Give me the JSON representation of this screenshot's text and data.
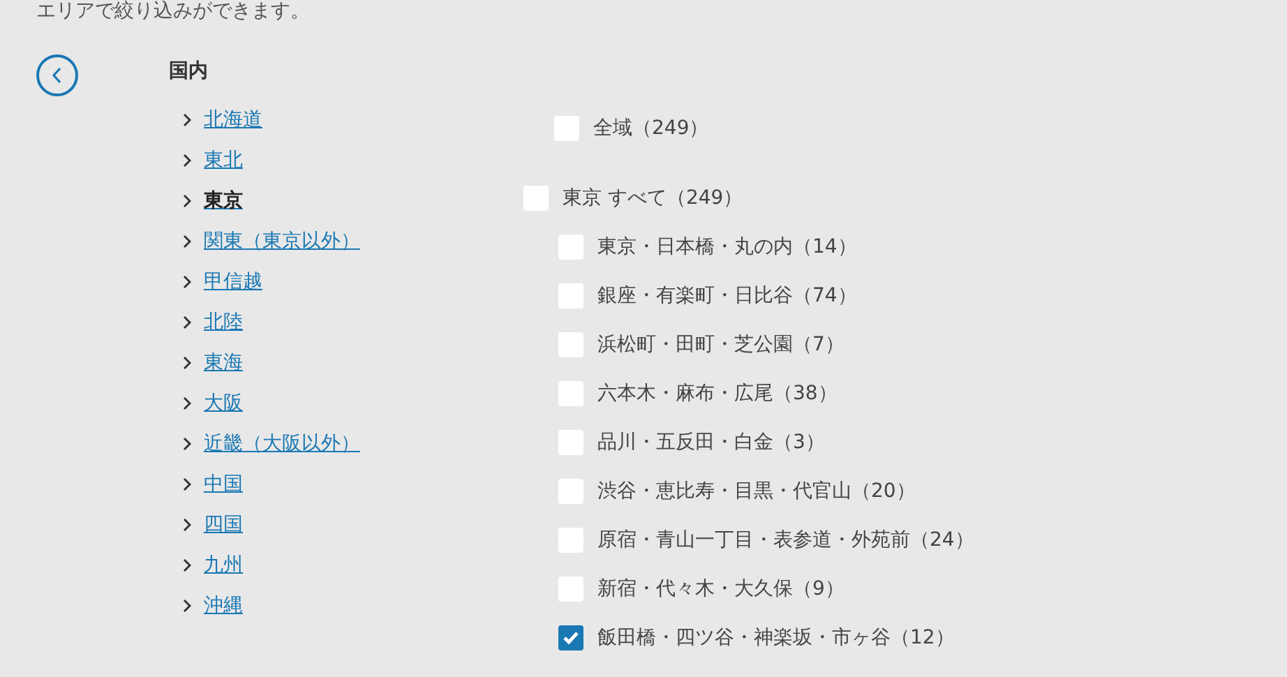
{
  "intro": "エリアで絞り込みができます。",
  "section_title": "国内",
  "regions": [
    {
      "label": "北海道",
      "selected": false
    },
    {
      "label": "東北",
      "selected": false
    },
    {
      "label": "東京",
      "selected": true
    },
    {
      "label": "関東（東京以外）",
      "selected": false
    },
    {
      "label": "甲信越",
      "selected": false
    },
    {
      "label": "北陸",
      "selected": false
    },
    {
      "label": "東海",
      "selected": false
    },
    {
      "label": "大阪",
      "selected": false
    },
    {
      "label": "近畿（大阪以外）",
      "selected": false
    },
    {
      "label": "中国",
      "selected": false
    },
    {
      "label": "四国",
      "selected": false
    },
    {
      "label": "九州",
      "selected": false
    },
    {
      "label": "沖縄",
      "selected": false
    }
  ],
  "filters": [
    {
      "kind": "all",
      "label": "全域（249）",
      "checked": false
    },
    {
      "kind": "group",
      "label": "東京 すべて（249）",
      "checked": false,
      "children": [
        {
          "label": "東京・日本橋・丸の内（14）",
          "checked": false
        },
        {
          "label": "銀座・有楽町・日比谷（74）",
          "checked": false
        },
        {
          "label": "浜松町・田町・芝公園（7）",
          "checked": false
        },
        {
          "label": "六本木・麻布・広尾（38）",
          "checked": false
        },
        {
          "label": "品川・五反田・白金（3）",
          "checked": false
        },
        {
          "label": "渋谷・恵比寿・目黒・代官山（20）",
          "checked": false
        },
        {
          "label": "原宿・青山一丁目・表参道・外苑前（24）",
          "checked": false
        },
        {
          "label": "新宿・代々木・大久保（9）",
          "checked": false
        },
        {
          "label": "飯田橋・四ツ谷・神楽坂・市ヶ谷（12）",
          "checked": true
        }
      ]
    }
  ]
}
